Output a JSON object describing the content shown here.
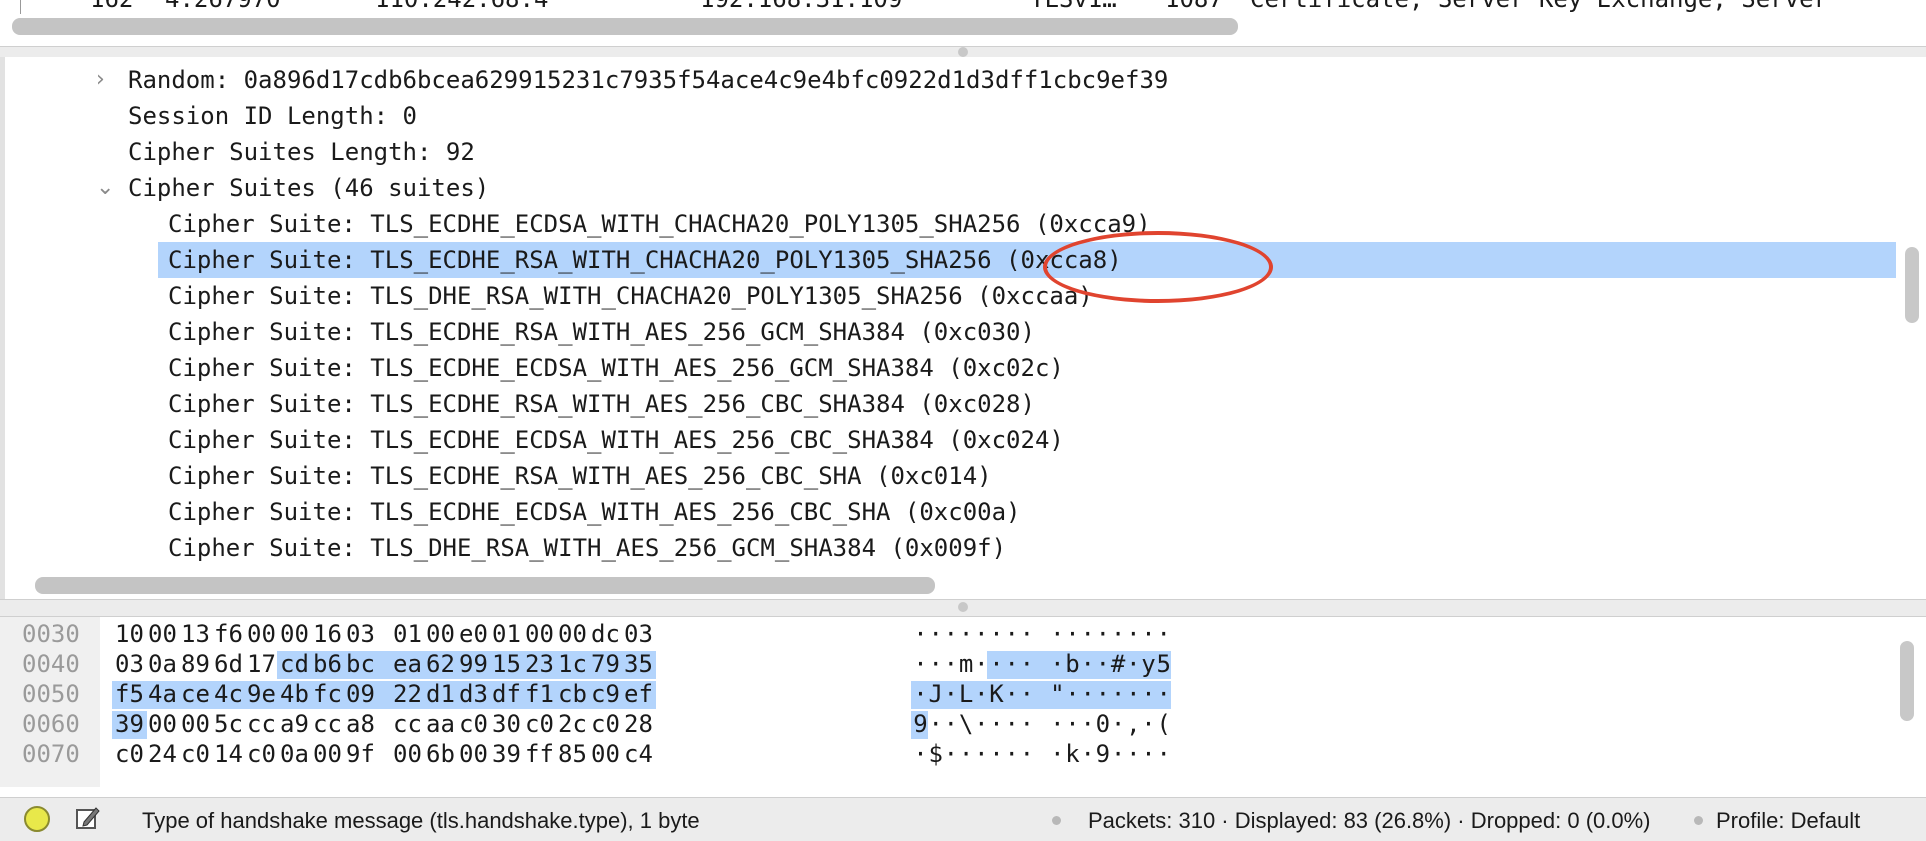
{
  "packet_list": {
    "row": {
      "no": "162",
      "time": "4.267970",
      "source": "110.242.68.4",
      "destination": "192.168.31.109",
      "protocol": "TLSv1…",
      "length": "1087",
      "info": "Certificate, Server Key Exchange, Server"
    }
  },
  "details": {
    "rows": [
      {
        "text": "Random: 0a896d17cdb6bcea629915231c7935f54ace4c9e4bfc0922d1d3dff1cbc9ef39",
        "arrow": "›"
      },
      {
        "text": "Session ID Length: 0",
        "arrow": ""
      },
      {
        "text": "Cipher Suites Length: 92",
        "arrow": ""
      },
      {
        "text": "Cipher Suites (46 suites)",
        "arrow": "⌄"
      },
      {
        "text": "Cipher Suite: TLS_ECDHE_ECDSA_WITH_CHACHA20_POLY1305_SHA256 (0xcca9)",
        "arrow": ""
      },
      {
        "text": "Cipher Suite: TLS_ECDHE_RSA_WITH_CHACHA20_POLY1305_SHA256 (0xcca8)",
        "arrow": ""
      },
      {
        "text": "Cipher Suite: TLS_DHE_RSA_WITH_CHACHA20_POLY1305_SHA256 (0xccaa)",
        "arrow": ""
      },
      {
        "text": "Cipher Suite: TLS_ECDHE_RSA_WITH_AES_256_GCM_SHA384 (0xc030)",
        "arrow": ""
      },
      {
        "text": "Cipher Suite: TLS_ECDHE_ECDSA_WITH_AES_256_GCM_SHA384 (0xc02c)",
        "arrow": ""
      },
      {
        "text": "Cipher Suite: TLS_ECDHE_RSA_WITH_AES_256_CBC_SHA384 (0xc028)",
        "arrow": ""
      },
      {
        "text": "Cipher Suite: TLS_ECDHE_ECDSA_WITH_AES_256_CBC_SHA384 (0xc024)",
        "arrow": ""
      },
      {
        "text": "Cipher Suite: TLS_ECDHE_RSA_WITH_AES_256_CBC_SHA (0xc014)",
        "arrow": ""
      },
      {
        "text": "Cipher Suite: TLS_ECDHE_ECDSA_WITH_AES_256_CBC_SHA (0xc00a)",
        "arrow": ""
      },
      {
        "text": "Cipher Suite: TLS_DHE_RSA_WITH_AES_256_GCM_SHA384 (0x009f)",
        "arrow": ""
      }
    ],
    "selected_index": 5
  },
  "bytes": {
    "rows": [
      {
        "offset": "0030",
        "hex": [
          "10",
          "00",
          "13",
          "f6",
          "00",
          "00",
          "16",
          "03",
          "01",
          "00",
          "e0",
          "01",
          "00",
          "00",
          "dc",
          "03"
        ],
        "ascii": "········ ········",
        "hl_from": -1,
        "hl_to": -1
      },
      {
        "offset": "0040",
        "hex": [
          "03",
          "0a",
          "89",
          "6d",
          "17",
          "cd",
          "b6",
          "bc",
          "ea",
          "62",
          "99",
          "15",
          "23",
          "1c",
          "79",
          "35"
        ],
        "ascii": "···m···· ·b··#·y5",
        "hl_from": 5,
        "hl_to": 15
      },
      {
        "offset": "0050",
        "hex": [
          "f5",
          "4a",
          "ce",
          "4c",
          "9e",
          "4b",
          "fc",
          "09",
          "22",
          "d1",
          "d3",
          "df",
          "f1",
          "cb",
          "c9",
          "ef"
        ],
        "ascii": "·J·L·K·· \"·······",
        "hl_from": 0,
        "hl_to": 15
      },
      {
        "offset": "0060",
        "hex": [
          "39",
          "00",
          "00",
          "5c",
          "cc",
          "a9",
          "cc",
          "a8",
          "cc",
          "aa",
          "c0",
          "30",
          "c0",
          "2c",
          "c0",
          "28"
        ],
        "ascii": "9··\\···· ···0·,·(",
        "hl_from": 0,
        "hl_to": 0
      },
      {
        "offset": "0070",
        "hex": [
          "c0",
          "24",
          "c0",
          "14",
          "c0",
          "0a",
          "00",
          "9f",
          "00",
          "6b",
          "00",
          "39",
          "ff",
          "85",
          "00",
          "c4"
        ],
        "ascii": "·$······ ·k·9····",
        "hl_from": -1,
        "hl_to": -1
      }
    ]
  },
  "statusbar": {
    "field_info": "Type of handshake message (tls.handshake.type), 1 byte",
    "stats": "Packets: 310 · Displayed: 83 (26.8%) · Dropped: 0 (0.0%)",
    "profile": "Profile: Default",
    "led_color": "#e8e84a"
  },
  "colors": {
    "selection": "#b3d4fc",
    "annotation": "#e0442f"
  }
}
